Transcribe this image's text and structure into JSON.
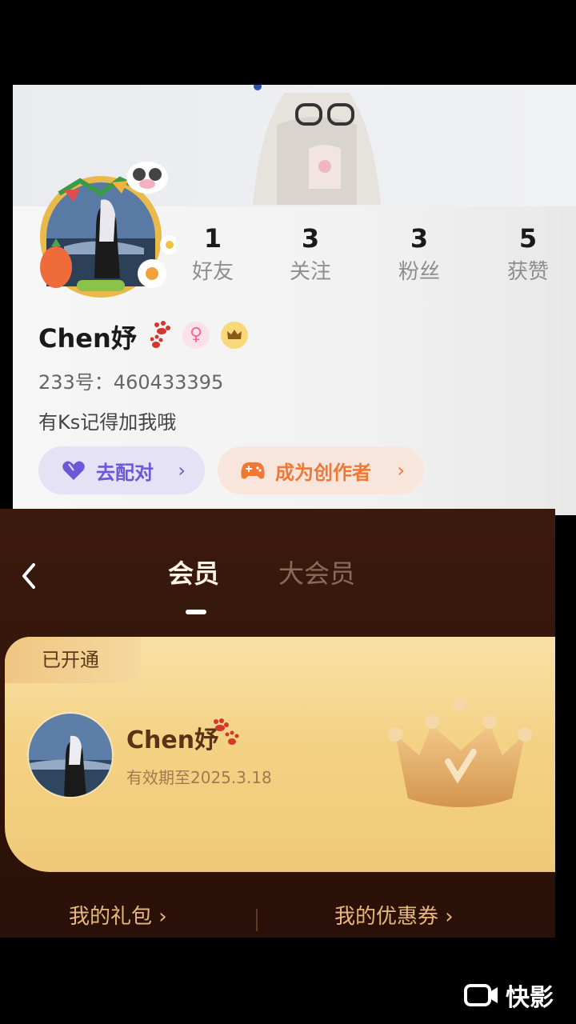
{
  "profile": {
    "stats": [
      {
        "value": "1",
        "label": "好友"
      },
      {
        "value": "3",
        "label": "关注"
      },
      {
        "value": "3",
        "label": "粉丝"
      },
      {
        "value": "5",
        "label": "获赞"
      }
    ],
    "username": "Chen妤",
    "gender_symbol": "♀",
    "uid": "233号：460433395",
    "bio": "有Ks记得加我哦",
    "match_button": "去配对",
    "creator_button": "成为创作者",
    "chevron": "›"
  },
  "member": {
    "tabs": [
      {
        "label": "会员",
        "active": true
      },
      {
        "label": "大会员",
        "active": false
      }
    ],
    "card": {
      "tag": "已开通",
      "name": "Chen妤",
      "expiry": "有效期至2025.3.18"
    },
    "links": {
      "gift": "我的礼包 ›",
      "coupon": "我的优惠券 ›"
    }
  },
  "watermark": {
    "text": "快影"
  },
  "colors": {
    "match_accent": "#6b58d8",
    "creator_accent": "#f07836",
    "member_bg": "#3b1a0d",
    "card_gold": "#f4d284"
  }
}
